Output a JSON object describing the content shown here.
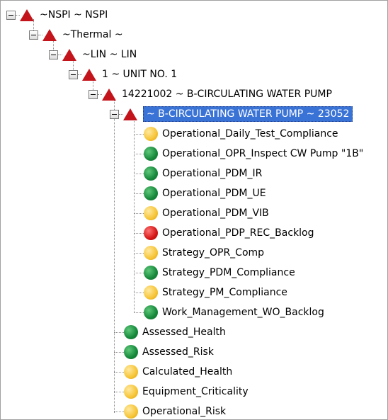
{
  "tree": {
    "nodes": [
      {
        "label": "~NSPI ~ NSPI",
        "kind": "triangle"
      },
      {
        "label": "~Thermal ~",
        "kind": "triangle"
      },
      {
        "label": "~LIN ~ LIN",
        "kind": "triangle"
      },
      {
        "label": "1 ~ UNIT NO. 1",
        "kind": "triangle"
      },
      {
        "label": "14221002 ~ B-CIRCULATING WATER PUMP",
        "kind": "triangle"
      },
      {
        "label": "~ B-CIRCULATING WATER PUMP ~ 23052",
        "kind": "triangle",
        "selected": true
      },
      {
        "label": "Operational_Daily_Test_Compliance",
        "status": "yellow"
      },
      {
        "label": "Operational_OPR_Inspect CW Pump \"1B\"",
        "status": "green"
      },
      {
        "label": "Operational_PDM_IR",
        "status": "green"
      },
      {
        "label": "Operational_PDM_UE",
        "status": "green"
      },
      {
        "label": "Operational_PDM_VIB",
        "status": "yellow"
      },
      {
        "label": "Operational_PDP_REC_Backlog",
        "status": "red"
      },
      {
        "label": "Strategy_OPR_Comp",
        "status": "yellow"
      },
      {
        "label": "Strategy_PDM_Compliance",
        "status": "green"
      },
      {
        "label": "Strategy_PM_Compliance",
        "status": "yellow"
      },
      {
        "label": "Work_Management_WO_Backlog",
        "status": "green"
      },
      {
        "label": "Assessed_Health",
        "status": "green"
      },
      {
        "label": "Assessed_Risk",
        "status": "green"
      },
      {
        "label": "Calculated_Health",
        "status": "yellow"
      },
      {
        "label": "Equipment_Criticality",
        "status": "yellow"
      },
      {
        "label": "Operational_Risk",
        "status": "yellow"
      }
    ]
  },
  "colors": {
    "alert_triangle": "#c4141b",
    "selection": "#3a73d6",
    "status_yellow": "#f6c435",
    "status_green": "#16883a",
    "status_red": "#d51515"
  }
}
